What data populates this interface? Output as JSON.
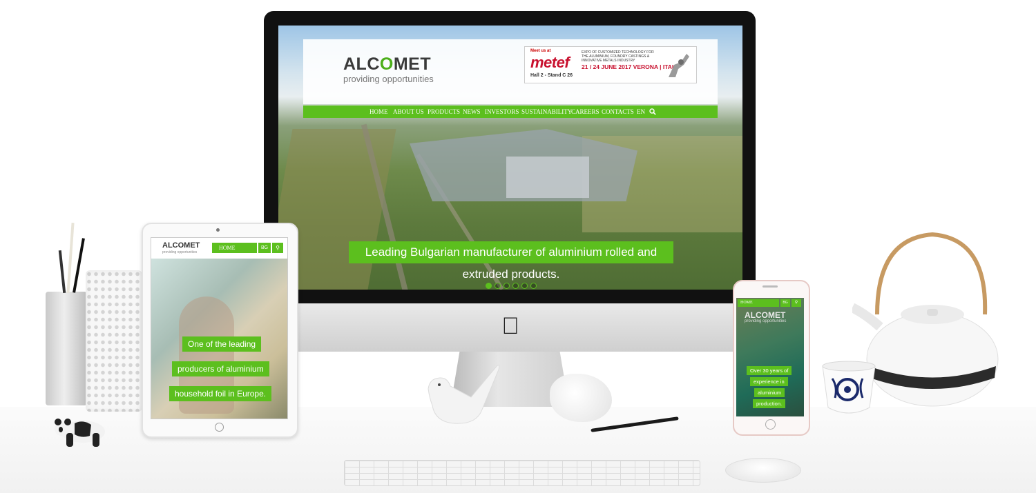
{
  "desktop_site": {
    "logo": {
      "pre": "ALC",
      "o": "O",
      "post": "MET",
      "tagline": "providing opportunities"
    },
    "banner": {
      "meet_us": "Meet us at",
      "brand": "metef",
      "expo_text": "EXPO OF CUSTOMIZED TECHNOLOGY FOR THE ALUMINIUM, FOUNDRY CASTINGS & INNOVATIVE METALS INDUSTRY",
      "date": "21 / 24 JUNE 2017 VERONA | ITALY",
      "hall": "Hall 2 - Stand C 26"
    },
    "nav": [
      "HOME",
      "ABOUT US",
      "PRODUCTS",
      "NEWS",
      "INVESTORS",
      "SUSTAINABILITY",
      "CAREERS",
      "CONTACTS",
      "EN"
    ],
    "search_icon": "search-icon",
    "slide_caption": "Leading Bulgarian manufacturer of aluminium rolled and extruded products.",
    "slider": {
      "count": 6,
      "active": 0
    }
  },
  "tablet_site": {
    "logo": "ALCOMET",
    "tagline": "providing opportunities",
    "menu": "HOME",
    "lang": "BG",
    "captions": [
      "One of the leading",
      "producers of aluminium",
      "household foil in Europe."
    ],
    "slider": {
      "count": 6,
      "active": 0
    }
  },
  "phone_site": {
    "menu": "HOME",
    "lang": "BG",
    "logo": "ALCOMET",
    "tagline": "providing opportunities",
    "captions": [
      "Over 30 years of",
      "experience in",
      "aluminium",
      "production."
    ]
  },
  "colors": {
    "accent": "#5cbf1e",
    "brand_red": "#c8102e"
  }
}
